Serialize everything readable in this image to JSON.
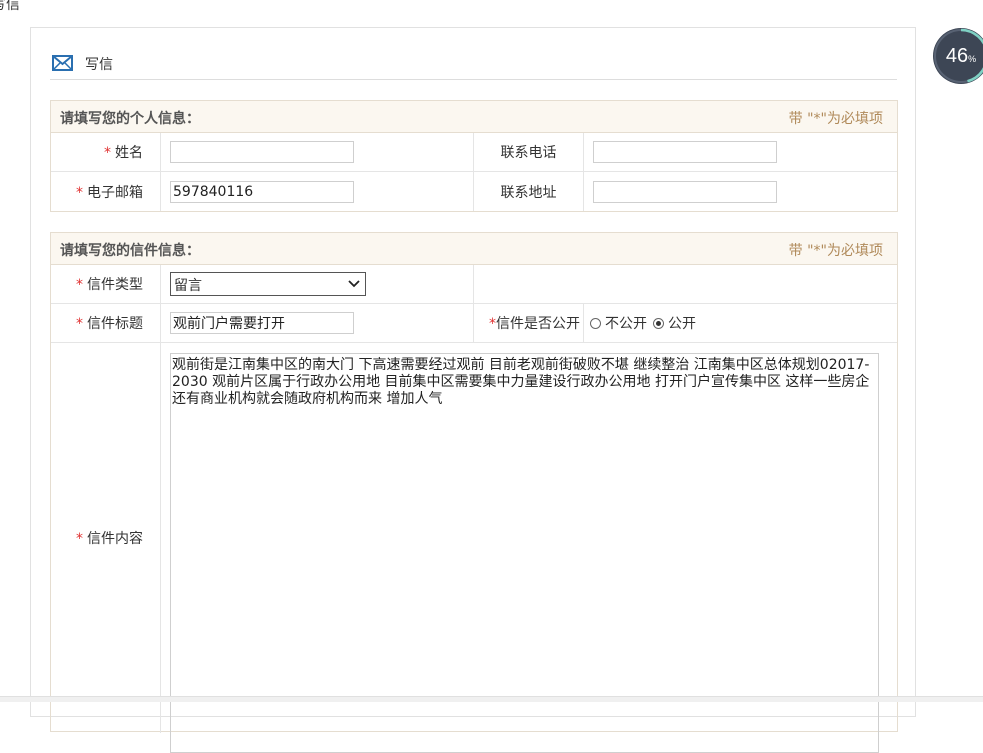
{
  "corner_title": "写信",
  "panel": {
    "title": "写信"
  },
  "personal": {
    "title": "请填写您的个人信息：",
    "note": "带 \"*\"为必填项",
    "name_label": "姓名",
    "name_value": "",
    "phone_label": "联系电话",
    "phone_value": "",
    "email_label": "电子邮箱",
    "email_value": "597840116",
    "address_label": "联系地址",
    "address_value": ""
  },
  "letter": {
    "title": "请填写您的信件信息：",
    "note": "带 \"*\"为必填项",
    "type_label": "信件类型",
    "type_value": "留言",
    "subject_label": "信件标题",
    "subject_value": "观前门户需要打开",
    "public_label": "信件是否公开",
    "public_options": [
      "不公开",
      "公开"
    ],
    "public_selected": "公开",
    "content_label": "信件内容",
    "content_value": "观前街是江南集中区的南大门 下高速需要经过观前 目前老观前街破败不堪 继续整治 江南集中区总体规划02017-2030  观前片区属于行政办公用地  目前集中区需要集中力量建设行政办公用地 打开门户宣传集中区 这样一些房企还有商业机构就会随政府机构而来 增加人气"
  },
  "required_mark": "*",
  "progress": {
    "value": "46",
    "unit": "%",
    "fraction": 0.46
  },
  "colors": {
    "section_bg": "#fbf7f0",
    "note": "#b08a5a",
    "required": "#e03030",
    "icon": "#2a6fb0",
    "progress_bg": "#3d4655",
    "progress_arc": "#7fd1c4"
  }
}
